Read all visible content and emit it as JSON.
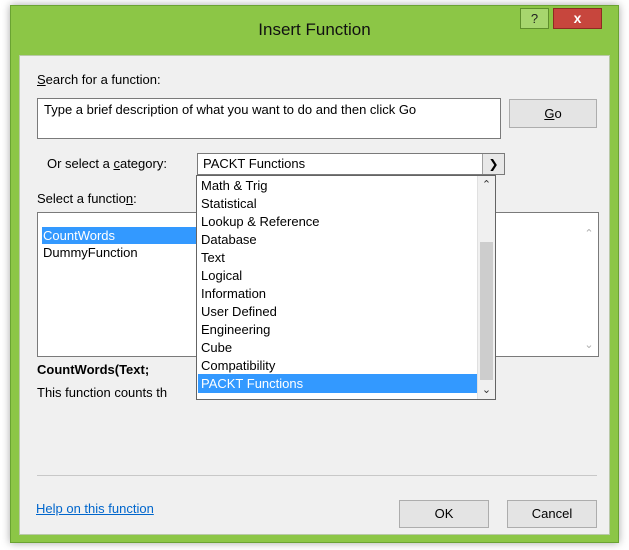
{
  "window": {
    "title": "Insert Function",
    "help_glyph": "?",
    "close_glyph": "x"
  },
  "search": {
    "label_prefix": "",
    "label_underlined": "S",
    "label_rest": "earch for a function:",
    "value": "Type a brief description of what you want to do and then click Go",
    "go_label_underlined": "G",
    "go_label_rest": "o"
  },
  "category": {
    "label_prefix": "Or select a ",
    "label_underlined": "c",
    "label_rest": "ategory:",
    "selected": "PACKT Functions",
    "options": [
      "Math & Trig",
      "Statistical",
      "Lookup & Reference",
      "Database",
      "Text",
      "Logical",
      "Information",
      "User Defined",
      "Engineering",
      "Cube",
      "Compatibility",
      "PACKT Functions"
    ]
  },
  "functions": {
    "label_prefix": "Select a functio",
    "label_underlined": "n",
    "label_rest": ":",
    "items": [
      "CountWords",
      "DummyFunction"
    ],
    "selected": "CountWords"
  },
  "details": {
    "signature": "CountWords(Text;",
    "signature_tail": "",
    "description": "This function counts th"
  },
  "footer": {
    "help_link": "Help on this function",
    "ok_label": "OK",
    "cancel_label": "Cancel"
  },
  "icons": {
    "scroll_up": "up-arrow-icon",
    "scroll_down": "down-arrow-icon",
    "dropdown": "chevron-down-icon"
  }
}
